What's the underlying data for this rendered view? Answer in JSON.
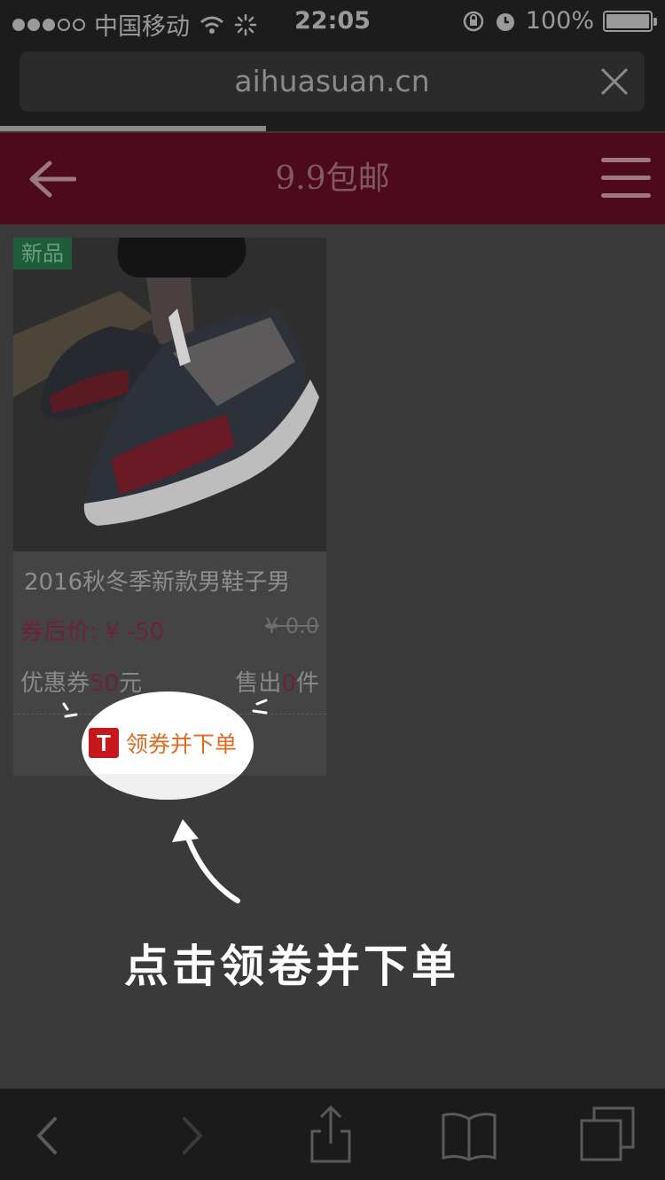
{
  "status_bar": {
    "carrier": "中国移动",
    "time": "22:05",
    "battery": "100%"
  },
  "browser": {
    "url": "aihuasuan.cn",
    "load_progress": 0.4
  },
  "header": {
    "title": "9.9包邮"
  },
  "product": {
    "badge": "新品",
    "name": "2016秋冬季新款男鞋子男",
    "price_label": "券后价: ¥ -50",
    "original_price": "¥ 0.0",
    "coupon_prefix": "优惠券",
    "coupon_amount": "50",
    "coupon_suffix": "元",
    "sold_prefix": "售出",
    "sold_count": "0",
    "sold_suffix": "件",
    "button_logo": "T",
    "button_label": "领券并下单"
  },
  "overlay": {
    "hint": "点击领卷并下单"
  },
  "icons": [
    "back-arrow-icon",
    "menu-icon",
    "clear-icon",
    "nav-back-icon",
    "nav-forward-icon",
    "share-icon",
    "bookmarks-icon",
    "tabs-icon",
    "wifi-icon",
    "lock-rotation-icon",
    "alarm-icon"
  ]
}
